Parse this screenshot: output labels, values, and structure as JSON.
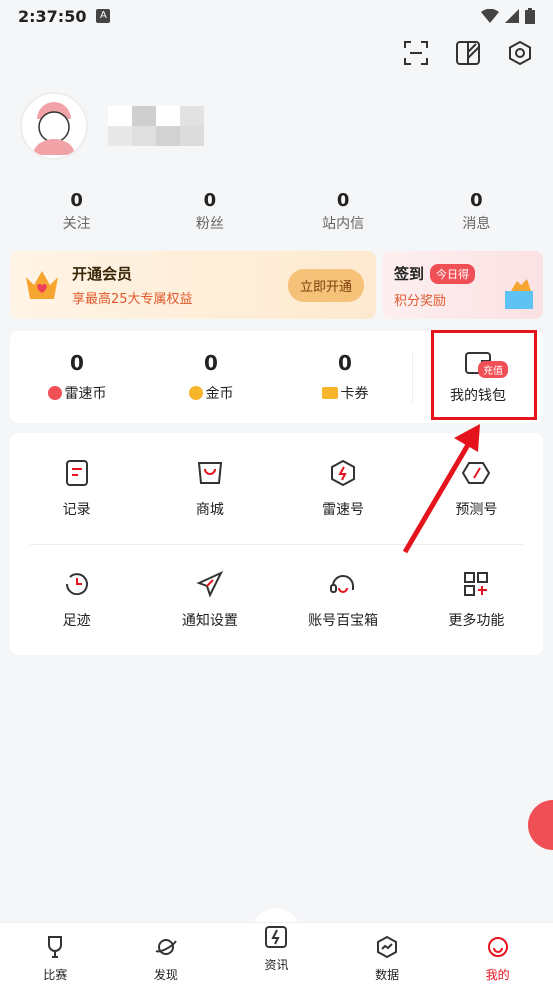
{
  "status": {
    "time": "2:37:50"
  },
  "stats": [
    {
      "num": "0",
      "label": "关注"
    },
    {
      "num": "0",
      "label": "粉丝"
    },
    {
      "num": "0",
      "label": "站内信"
    },
    {
      "num": "0",
      "label": "消息"
    }
  ],
  "vip": {
    "title": "开通会员",
    "subtitle": "享最高25大专属权益",
    "button": "立即开通"
  },
  "sign": {
    "title": "签到",
    "tag": "今日得",
    "subtitle": "积分奖励"
  },
  "wallet": {
    "items": [
      {
        "num": "0",
        "label": "雷速币"
      },
      {
        "num": "0",
        "label": "金币"
      },
      {
        "num": "0",
        "label": "卡券"
      }
    ],
    "my_label": "我的钱包",
    "badge": "充值"
  },
  "grid": {
    "row1": [
      "记录",
      "商城",
      "雷速号",
      "预测号"
    ],
    "row2": [
      "足迹",
      "通知设置",
      "账号百宝箱",
      "更多功能"
    ]
  },
  "tabs": [
    "比赛",
    "发现",
    "资讯",
    "数据",
    "我的"
  ]
}
